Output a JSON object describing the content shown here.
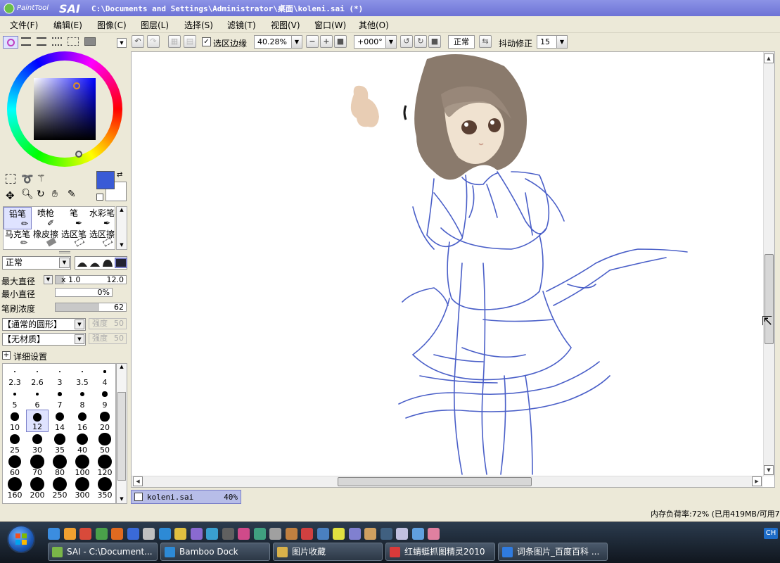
{
  "window": {
    "title": "C:\\Documents and Settings\\Administrator\\桌面\\koleni.sai (*)",
    "logo_text": "PaintTool SAI"
  },
  "menu": [
    "文件(F)",
    "编辑(E)",
    "图像(C)",
    "图层(L)",
    "选择(S)",
    "滤镜(T)",
    "视图(V)",
    "窗口(W)",
    "其他(O)"
  ],
  "toolbar": {
    "selection_edge_label": "选区边缘",
    "selection_edge_checked": true,
    "zoom": "40.28%",
    "rotation": "+000°",
    "blend_mode": "正常",
    "stabilizer_label": "抖动修正",
    "stabilizer_value": "15"
  },
  "brush_tools": [
    "铅笔",
    "喷枪",
    "笔",
    "水彩笔",
    "马克笔",
    "橡皮擦",
    "选区笔",
    "选区擦"
  ],
  "brush_settings": {
    "mode": "正常",
    "max_diameter_label": "最大直径",
    "max_diameter_mult": "x 1.0",
    "max_diameter_value": "12.0",
    "min_diameter_label": "最小直径",
    "min_diameter_value": "0%",
    "density_label": "笔刷浓度",
    "density_value": "62",
    "density_fraction": 0.62,
    "shape": "【通常的圆形】",
    "shape_strength_label": "强度",
    "shape_strength": "50",
    "texture": "【无材质】",
    "texture_strength_label": "强度",
    "texture_strength": "50",
    "detail_label": "详细设置"
  },
  "brush_sizes": [
    "2.3",
    "2.6",
    "3",
    "3.5",
    "4",
    "5",
    "6",
    "7",
    "8",
    "9",
    "10",
    "12",
    "14",
    "16",
    "20",
    "25",
    "30",
    "35",
    "40",
    "50",
    "60",
    "70",
    "80",
    "100",
    "120",
    "160",
    "200",
    "250",
    "300",
    "350"
  ],
  "selected_brush_size": "12",
  "colors": {
    "primary": "#3a5bd6",
    "secondary": "#ffffff",
    "sketch_line": "#4a5fc8",
    "hair": "#8a7a6c"
  },
  "document_tab": {
    "name": "koleni.sai",
    "zoom": "40%"
  },
  "status": "内存负荷率:72% (已用419MB/可用7",
  "taskbar": {
    "tasks": [
      {
        "label": "SAI - C:\\Document...",
        "color": "#7ab648"
      },
      {
        "label": "Bamboo Dock",
        "color": "#2d8ad6"
      },
      {
        "label": "图片收藏",
        "color": "#d9b14a"
      },
      {
        "label": "红蜻蜓抓图精灵2010",
        "color": "#d93a3a"
      },
      {
        "label": "词条图片_百度百科 ...",
        "color": "#2f7be0"
      }
    ],
    "ime": "CH"
  }
}
